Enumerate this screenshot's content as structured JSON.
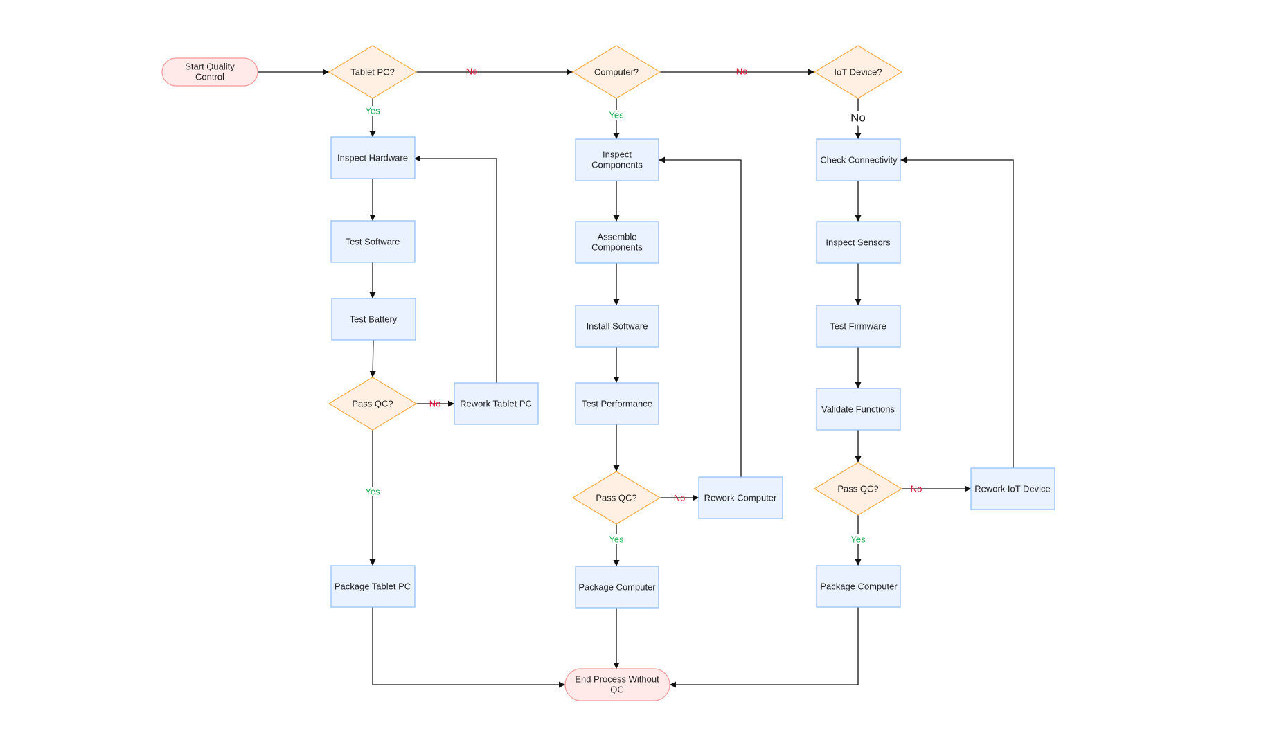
{
  "colors": {
    "terminal_fill": "#ffe9e9",
    "terminal_stroke": "#f29a9a",
    "decision_fill": "#fff0e3",
    "decision_stroke": "#f7ac44",
    "process_fill": "#ebf2ff",
    "process_stroke": "#90bdf5",
    "yes": "#1fae55",
    "no": "#e0173a"
  },
  "nodes": {
    "start": [
      "Start Quality",
      "Control"
    ],
    "tablet_q": "Tablet PC?",
    "computer_q": "Computer?",
    "iot_q": "IoT Device?",
    "inspect_hardware": "Inspect Hardware",
    "test_software": "Test Software",
    "test_battery": "Test Battery",
    "tablet_pass": "Pass QC?",
    "rework_tablet": "Rework Tablet PC",
    "package_tablet": "Package Tablet PC",
    "inspect_components": [
      "Inspect",
      "Components"
    ],
    "assemble_components": [
      "Assemble",
      "Components"
    ],
    "install_software": "Install Software",
    "test_performance": "Test Performance",
    "computer_pass": "Pass QC?",
    "rework_computer": "Rework Computer",
    "package_computer": "Package Computer",
    "check_connectivity": "Check Connectivity",
    "inspect_sensors": "Inspect Sensors",
    "test_firmware": "Test Firmware",
    "validate_functions": "Validate Functions",
    "iot_pass": "Pass QC?",
    "rework_iot": "Rework IoT Device",
    "package_iot": "Package Computer",
    "end": [
      "End Process Without",
      "QC"
    ]
  },
  "edge_labels": {
    "tablet_no": "No",
    "computer_no": "No",
    "tablet_yes": "Yes",
    "computer_yes": "Yes",
    "iot_no": "No",
    "tablet_pass_no": "No",
    "tablet_pass_yes": "Yes",
    "computer_pass_no": "No",
    "computer_pass_yes": "Yes",
    "iot_pass_no": "No",
    "iot_pass_yes": "Yes"
  }
}
